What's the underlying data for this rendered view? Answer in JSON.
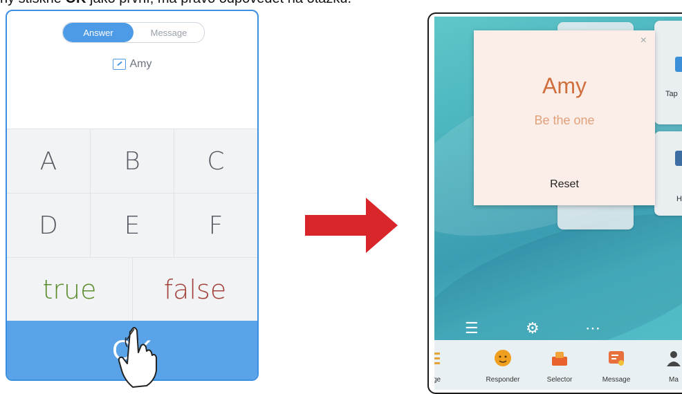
{
  "caption": {
    "prefix": "ny stiskne ",
    "bold": "OK",
    "suffix": " jako první, má právo odpovědět na otázku."
  },
  "left_phone": {
    "tabs": [
      {
        "label": "Answer",
        "active": true
      },
      {
        "label": "Message",
        "active": false
      }
    ],
    "username": "Amy",
    "keys": [
      "A",
      "B",
      "C",
      "D",
      "E",
      "F"
    ],
    "true_label": "true",
    "false_label": "false",
    "ok_label": "OK",
    "colors": {
      "accent": "#4d9ae6",
      "ok_bar": "#5aa3e8",
      "true": "#5a8d2c",
      "false": "#a3433c"
    }
  },
  "right_tablet": {
    "card": {
      "name": "Amy",
      "slogan": "Be the one",
      "reset": "Reset",
      "close": "×"
    },
    "side_tiles": [
      {
        "label": "Tap"
      },
      {
        "label": "H"
      }
    ],
    "dock": [
      {
        "label": "udge",
        "icon": "judge-icon"
      },
      {
        "label": "Responder",
        "icon": "responder-icon"
      },
      {
        "label": "Selector",
        "icon": "selector-icon"
      },
      {
        "label": "Message",
        "icon": "message-icon"
      },
      {
        "label": "Ma",
        "icon": "user-icon"
      }
    ],
    "colors": {
      "card_bg": "#fbeee9",
      "name": "#cf6f3d",
      "slogan": "#e0a07a"
    }
  },
  "arrow": {
    "color": "#d8262b"
  }
}
